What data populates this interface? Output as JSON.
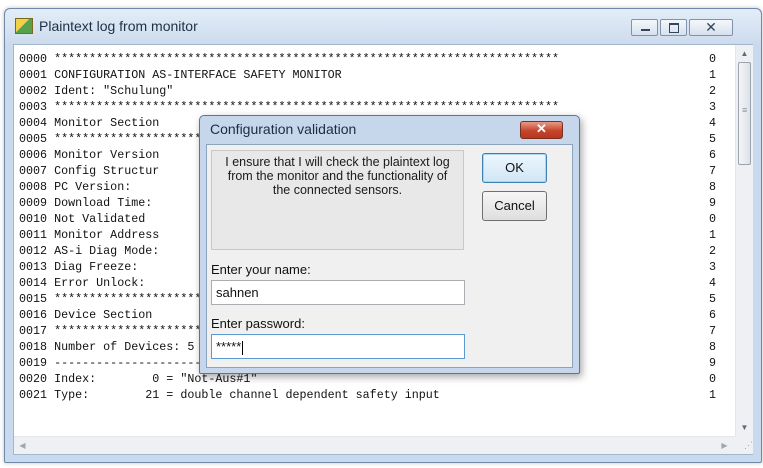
{
  "window": {
    "title": "Plaintext log from monitor",
    "min_glyph": "",
    "close_glyph": "✕"
  },
  "log": {
    "lines": [
      "0000 ************************************************************************",
      "0001 CONFIGURATION AS-INTERFACE SAFETY MONITOR",
      "0002 Ident: \"Schulung\"",
      "0003 ************************************************************************",
      "0004 Monitor Section",
      "0005 ************************************************************************",
      "0006 Monitor Version",
      "0007 Config Structur",
      "0008 PC Version:",
      "0009 Download Time:",
      "0010 Not Validated",
      "0011 Monitor Address                                               ices",
      "0012 AS-i Diag Mode:",
      "0013 Diag Freeze:",
      "0014 Error Unlock:",
      "0015 ************************************************************************",
      "0016 Device Section",
      "0017 ************************************************************************",
      "0018 Number of Devices: 5",
      "0019 ------------------------------------------------------------------------",
      "0020 Index:        0 = \"Not-Aus#1\"",
      "0021 Type:        21 = double channel dependent safety input"
    ],
    "line_numbers": [
      "0",
      "1",
      "2",
      "3",
      "4",
      "5",
      "6",
      "7",
      "8",
      "9",
      "0",
      "1",
      "2",
      "3",
      "4",
      "5",
      "6",
      "7",
      "8",
      "9",
      "0",
      "1"
    ]
  },
  "scrollbar": {
    "up_arrow": "▲",
    "down_arrow": "▼",
    "left_arrow": "◀",
    "right_arrow": "▶",
    "grip": "≡",
    "resize_grip": "⋰"
  },
  "dialog": {
    "title": "Configuration validation",
    "close_glyph": "✕",
    "notice": "I ensure that I will check the plaintext log from the monitor and the functionality of the connected sensors.",
    "ok_label": "OK",
    "cancel_label": "Cancel",
    "name_label": "Enter your name:",
    "name_value": "sahnen",
    "password_label": "Enter password:",
    "password_value": "*****"
  }
}
